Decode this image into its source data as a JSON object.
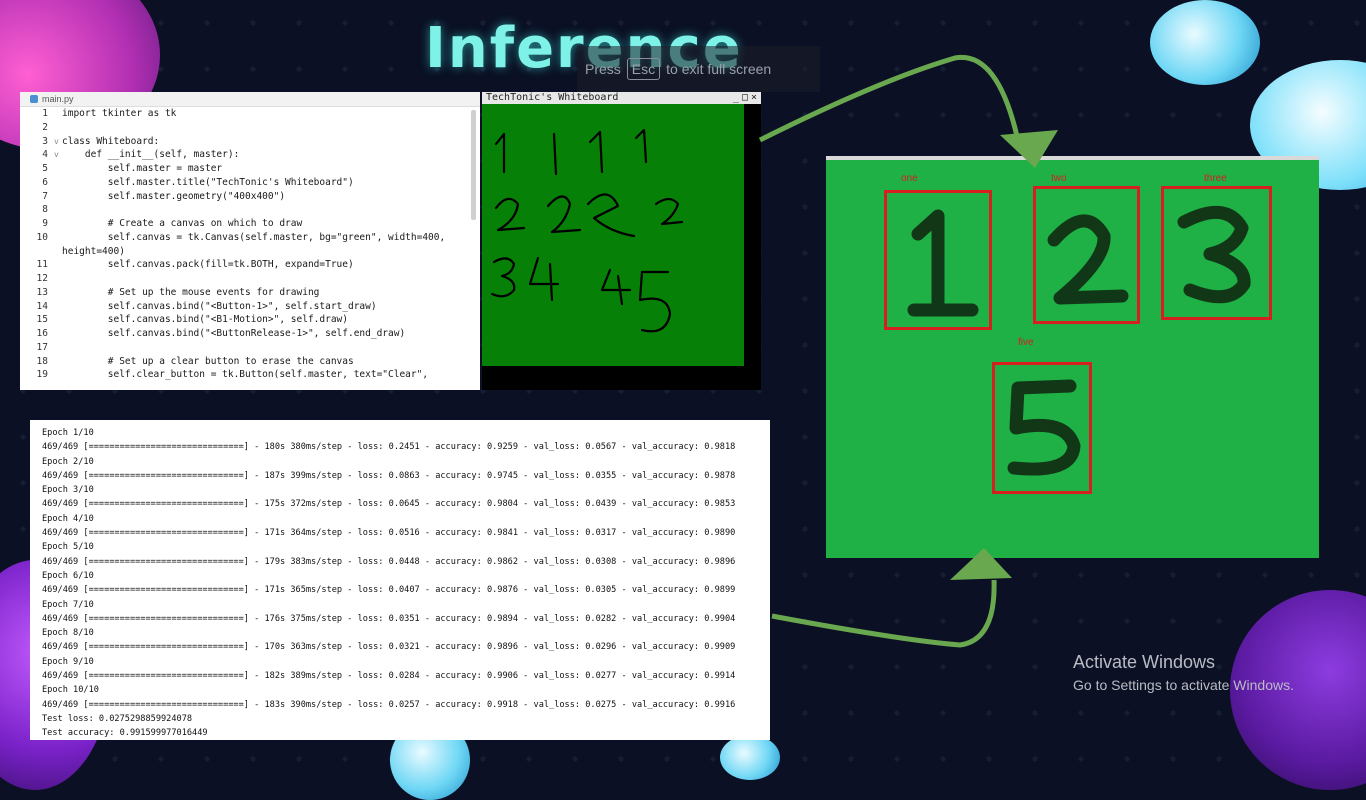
{
  "slide": {
    "title": "Inference",
    "esc_hint": {
      "before": "Press",
      "key": "Esc",
      "after": "to exit full screen"
    }
  },
  "editor": {
    "tab": "main.py",
    "lines": [
      {
        "n": "1",
        "fold": "",
        "text": "import tkinter as tk"
      },
      {
        "n": "2",
        "fold": "",
        "text": ""
      },
      {
        "n": "3",
        "fold": "v",
        "text": "class Whiteboard:"
      },
      {
        "n": "4",
        "fold": "v",
        "text": "    def __init__(self, master):"
      },
      {
        "n": "5",
        "fold": "",
        "text": "        self.master = master"
      },
      {
        "n": "6",
        "fold": "",
        "text": "        self.master.title(\"TechTonic's Whiteboard\")"
      },
      {
        "n": "7",
        "fold": "",
        "text": "        self.master.geometry(\"400x400\")"
      },
      {
        "n": "8",
        "fold": "",
        "text": ""
      },
      {
        "n": "9",
        "fold": "",
        "text": "        # Create a canvas on which to draw"
      },
      {
        "n": "10",
        "fold": "",
        "text": "        self.canvas = tk.Canvas(self.master, bg=\"green\", width=400,"
      },
      {
        "n": "",
        "fold": "",
        "text": "height=400)"
      },
      {
        "n": "11",
        "fold": "",
        "text": "        self.canvas.pack(fill=tk.BOTH, expand=True)"
      },
      {
        "n": "12",
        "fold": "",
        "text": ""
      },
      {
        "n": "13",
        "fold": "",
        "text": "        # Set up the mouse events for drawing"
      },
      {
        "n": "14",
        "fold": "",
        "text": "        self.canvas.bind(\"<Button-1>\", self.start_draw)"
      },
      {
        "n": "15",
        "fold": "",
        "text": "        self.canvas.bind(\"<B1-Motion>\", self.draw)"
      },
      {
        "n": "16",
        "fold": "",
        "text": "        self.canvas.bind(\"<ButtonRelease-1>\", self.end_draw)"
      },
      {
        "n": "17",
        "fold": "",
        "text": ""
      },
      {
        "n": "18",
        "fold": "",
        "text": "        # Set up a clear button to erase the canvas"
      },
      {
        "n": "19",
        "fold": "",
        "text": "        self.clear_button = tk.Button(self.master, text=\"Clear\","
      }
    ]
  },
  "whiteboard": {
    "title": "TechTonic's Whiteboard",
    "drawn_digits": [
      "1",
      "1",
      "1",
      "1",
      "2",
      "2",
      "2",
      "2",
      "3",
      "4",
      "4",
      "5"
    ]
  },
  "training_log": {
    "lines": [
      "Epoch 1/10",
      "469/469 [==============================] - 180s 380ms/step - loss: 0.2451 - accuracy: 0.9259 - val_loss: 0.0567 - val_accuracy: 0.9818",
      "Epoch 2/10",
      "469/469 [==============================] - 187s 399ms/step - loss: 0.0863 - accuracy: 0.9745 - val_loss: 0.0355 - val_accuracy: 0.9878",
      "Epoch 3/10",
      "469/469 [==============================] - 175s 372ms/step - loss: 0.0645 - accuracy: 0.9804 - val_loss: 0.0439 - val_accuracy: 0.9853",
      "Epoch 4/10",
      "469/469 [==============================] - 171s 364ms/step - loss: 0.0516 - accuracy: 0.9841 - val_loss: 0.0317 - val_accuracy: 0.9890",
      "Epoch 5/10",
      "469/469 [==============================] - 179s 383ms/step - loss: 0.0448 - accuracy: 0.9862 - val_loss: 0.0308 - val_accuracy: 0.9896",
      "Epoch 6/10",
      "469/469 [==============================] - 171s 365ms/step - loss: 0.0407 - accuracy: 0.9876 - val_loss: 0.0305 - val_accuracy: 0.9899",
      "Epoch 7/10",
      "469/469 [==============================] - 176s 375ms/step - loss: 0.0351 - accuracy: 0.9894 - val_loss: 0.0282 - val_accuracy: 0.9904",
      "Epoch 8/10",
      "469/469 [==============================] - 170s 363ms/step - loss: 0.0321 - accuracy: 0.9896 - val_loss: 0.0296 - val_accuracy: 0.9909",
      "Epoch 9/10",
      "469/469 [==============================] - 182s 389ms/step - loss: 0.0284 - accuracy: 0.9906 - val_loss: 0.0277 - val_accuracy: 0.9914",
      "Epoch 10/10",
      "469/469 [==============================] - 183s 390ms/step - loss: 0.0257 - accuracy: 0.9918 - val_loss: 0.0275 - val_accuracy: 0.9916",
      "Test loss: 0.0275298859924078",
      "Test accuracy: 0.991599977016449"
    ]
  },
  "detections": [
    {
      "label": "one",
      "digit": "1"
    },
    {
      "label": "two",
      "digit": "2"
    },
    {
      "label": "three",
      "digit": "3"
    },
    {
      "label": "five",
      "digit": "5"
    }
  ],
  "watermark": {
    "title": "Activate Windows",
    "subtitle": "Go to Settings to activate Windows."
  },
  "colors": {
    "title": "#7ef2e6",
    "whiteboard_bg": "#068006",
    "result_bg": "#1fb046",
    "detection_box": "#d62020",
    "arrow": "#6aa84f"
  }
}
